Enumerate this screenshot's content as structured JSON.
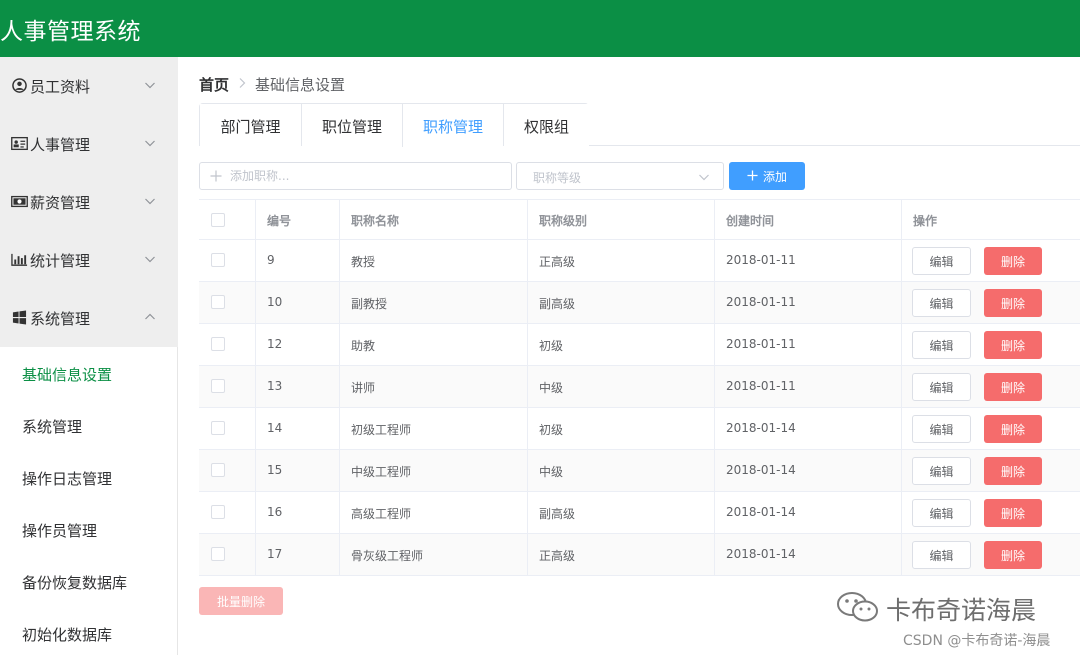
{
  "app": {
    "title": "人事管理系统"
  },
  "sidebar": {
    "groups": [
      {
        "label": "员工资料",
        "icon": "user-circle-icon",
        "expanded": false
      },
      {
        "label": "人事管理",
        "icon": "id-card-icon",
        "expanded": false
      },
      {
        "label": "薪资管理",
        "icon": "money-icon",
        "expanded": false
      },
      {
        "label": "统计管理",
        "icon": "bar-chart-icon",
        "expanded": false
      },
      {
        "label": "系统管理",
        "icon": "windows-icon",
        "expanded": true
      }
    ],
    "submenu": [
      {
        "label": "基础信息设置",
        "active": true
      },
      {
        "label": "系统管理",
        "active": false
      },
      {
        "label": "操作日志管理",
        "active": false
      },
      {
        "label": "操作员管理",
        "active": false
      },
      {
        "label": "备份恢复数据库",
        "active": false
      },
      {
        "label": "初始化数据库",
        "active": false
      }
    ]
  },
  "breadcrumb": {
    "home": "首页",
    "current": "基础信息设置"
  },
  "tabs": [
    {
      "label": "部门管理",
      "active": false
    },
    {
      "label": "职位管理",
      "active": false
    },
    {
      "label": "职称管理",
      "active": true
    },
    {
      "label": "权限组",
      "active": false
    }
  ],
  "toolbar": {
    "name_placeholder": "添加职称...",
    "level_placeholder": "职称等级",
    "add_label": "添加"
  },
  "table": {
    "headers": [
      "编号",
      "职称名称",
      "职称级别",
      "创建时间",
      "操作"
    ],
    "rows": [
      {
        "id": "9",
        "name": "教授",
        "level": "正高级",
        "created": "2018-01-11"
      },
      {
        "id": "10",
        "name": "副教授",
        "level": "副高级",
        "created": "2018-01-11"
      },
      {
        "id": "12",
        "name": "助教",
        "level": "初级",
        "created": "2018-01-11"
      },
      {
        "id": "13",
        "name": "讲师",
        "level": "中级",
        "created": "2018-01-11"
      },
      {
        "id": "14",
        "name": "初级工程师",
        "level": "初级",
        "created": "2018-01-14"
      },
      {
        "id": "15",
        "name": "中级工程师",
        "level": "中级",
        "created": "2018-01-14"
      },
      {
        "id": "16",
        "name": "高级工程师",
        "level": "副高级",
        "created": "2018-01-14"
      },
      {
        "id": "17",
        "name": "骨灰级工程师",
        "level": "正高级",
        "created": "2018-01-14"
      }
    ],
    "edit_label": "编辑",
    "delete_label": "删除"
  },
  "batch_delete_label": "批量删除",
  "watermark": {
    "name": "卡布奇诺海晨",
    "csdn": "CSDN @卡布奇诺-海晨"
  },
  "colors": {
    "header": "#0b8f45",
    "primary": "#409eff",
    "danger": "#f56c6c",
    "danger_disabled": "#fab6b6",
    "active_menu": "#0b8f45"
  }
}
